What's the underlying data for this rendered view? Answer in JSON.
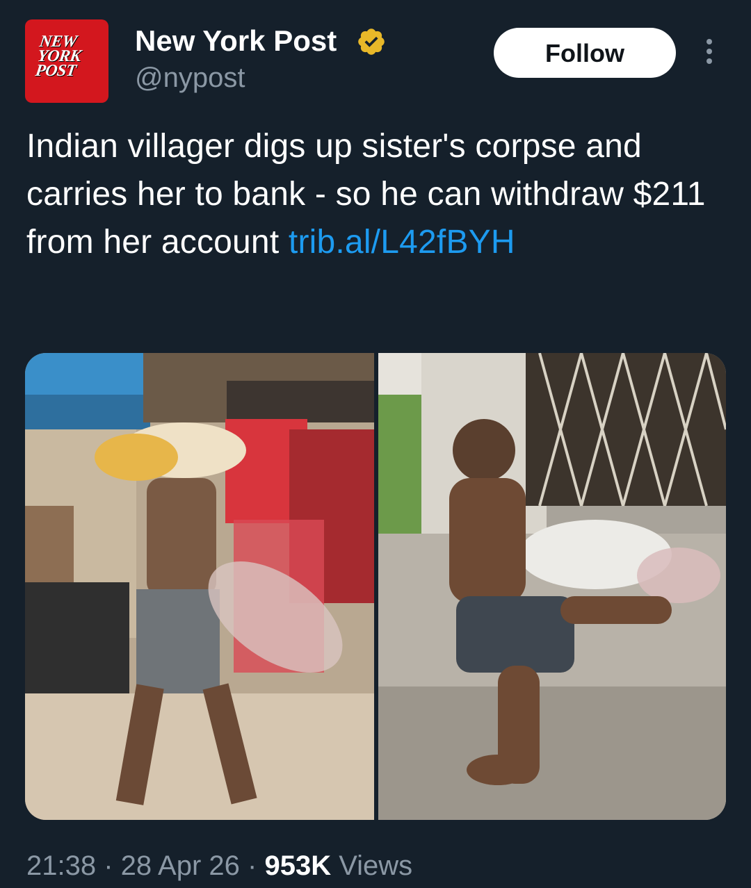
{
  "account": {
    "avatar_text_line1": "NEW",
    "avatar_text_line2": "YORK",
    "avatar_text_line3": "POST",
    "display_name": "New York Post",
    "handle": "@nypost",
    "verified_icon": "verified-gold-badge-icon"
  },
  "actions": {
    "follow_label": "Follow",
    "more_icon": "more-vertical-icon"
  },
  "tweet": {
    "text": "Indian villager digs up sister's corpse and carries her to bank - so he can withdraw $211 from her account ",
    "link_text": "trib.al/L42fBYH"
  },
  "media": {
    "count": 2,
    "image_1": "man-carrying-sack-on-street-photo",
    "image_2": "man-sitting-beside-sack-at-bank-photo"
  },
  "meta": {
    "time": "21:38",
    "separator": " · ",
    "date": "28 Apr 26",
    "views_count": "953K",
    "views_label": " Views"
  },
  "colors": {
    "background": "#15202b",
    "text": "#ffffff",
    "secondary_text": "#8b98a5",
    "link": "#1d9bf0",
    "brand_red": "#d3171e",
    "verified_gold": "#e8b829"
  }
}
